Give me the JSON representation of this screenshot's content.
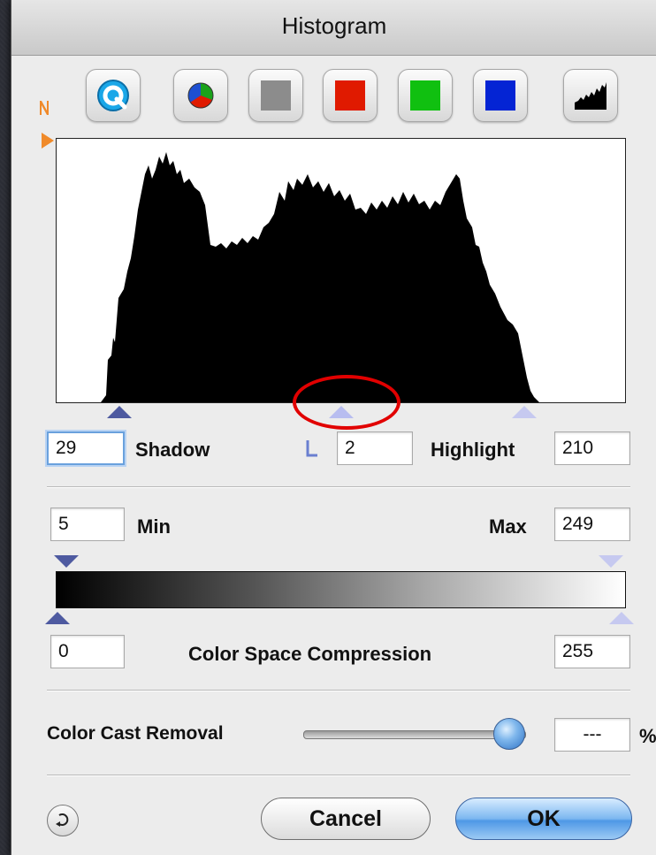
{
  "window": {
    "title": "Histogram"
  },
  "toolbar": {
    "buttons": [
      {
        "name": "auto-icon"
      },
      {
        "name": "pie-chart-icon"
      },
      {
        "name": "gray-channel",
        "color": "#8c8c8c"
      },
      {
        "name": "red-channel",
        "color": "#e01a00"
      },
      {
        "name": "green-channel",
        "color": "#10c010"
      },
      {
        "name": "blue-channel",
        "color": "#0424d4"
      },
      {
        "name": "histogram-mode-icon"
      }
    ]
  },
  "levels": {
    "shadow_value": "29",
    "shadow_label": "Shadow",
    "midpoint_value": "2",
    "highlight_label": "Highlight",
    "highlight_value": "210"
  },
  "output": {
    "min_value": "5",
    "min_label": "Min",
    "max_label": "Max",
    "max_value": "249"
  },
  "compression": {
    "low_value": "0",
    "label": "Color Space Compression",
    "high_value": "255"
  },
  "cast": {
    "label": "Color Cast Removal",
    "value": "---",
    "unit": "%",
    "slider_fraction": 0.9
  },
  "buttons": {
    "cancel": "Cancel",
    "ok": "OK"
  },
  "colors": {
    "accent_orange": "#f08a2a",
    "triangle_blue": "#5566aa",
    "triangle_light": "#c0c4ee",
    "annotation_red": "#e10000"
  }
}
